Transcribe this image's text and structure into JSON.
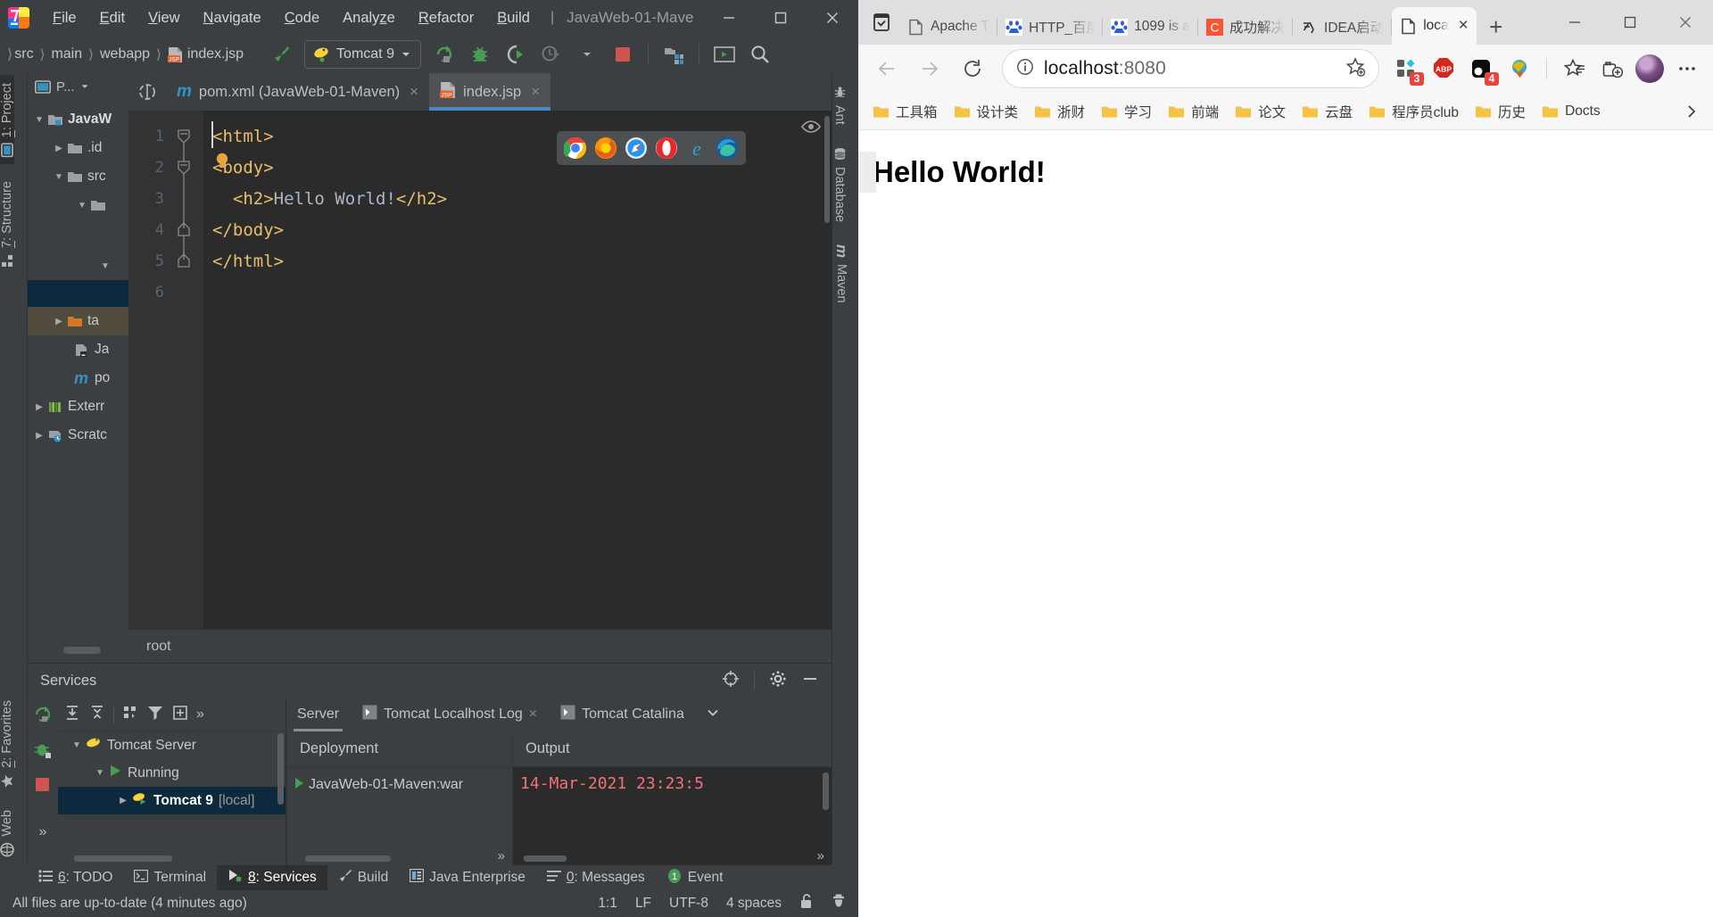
{
  "ide": {
    "window_title": "JavaWeb-01-Mave",
    "menu": [
      {
        "label": "File",
        "mn": "F"
      },
      {
        "label": "Edit",
        "mn": "E"
      },
      {
        "label": "View",
        "mn": "V"
      },
      {
        "label": "Navigate",
        "mn": "N"
      },
      {
        "label": "Code",
        "mn": "C"
      },
      {
        "label": "Analyze",
        "mn": "z"
      },
      {
        "label": "Refactor",
        "mn": "R"
      },
      {
        "label": "Build",
        "mn": "B"
      }
    ],
    "menu_separator": "|",
    "window_buttons": {
      "minimize": "minimize-icon",
      "maximize": "maximize-icon",
      "close": "close-icon"
    },
    "breadcrumb": [
      "src",
      "main",
      "webapp",
      "index.jsp"
    ],
    "run_config": "Tomcat 9",
    "toolbar_icons": [
      "hammer-icon",
      "run-icon",
      "debug-icon",
      "run-coverage-icon",
      "profile-icon",
      "stop-icon",
      "project-structure-icon",
      "update-app-icon",
      "search-everywhere-icon"
    ],
    "left_tool_tabs": [
      {
        "label": "1: Project",
        "mn": "1",
        "icon": "project-icon",
        "selected": true
      },
      {
        "label": "7: Structure",
        "mn": "7",
        "icon": "structure-icon",
        "selected": false
      },
      {
        "label": "2: Favorites",
        "mn": "2",
        "icon": "star-icon",
        "selected": false
      },
      {
        "label": "Web",
        "mn": "",
        "icon": "web-icon",
        "selected": false
      }
    ],
    "right_tool_tabs": [
      {
        "label": "Ant",
        "icon": "ant-icon"
      },
      {
        "label": "Database",
        "icon": "database-icon"
      },
      {
        "label": "Maven",
        "icon": "maven-icon"
      }
    ],
    "project_panel": {
      "title": "P...",
      "tree": [
        {
          "label": "JavaW",
          "indent": 0,
          "arrow": "down",
          "icon": "module-folder",
          "bold": true,
          "sel": ""
        },
        {
          "label": ".id",
          "indent": 1,
          "arrow": "right",
          "icon": "folder",
          "bold": false,
          "sel": ""
        },
        {
          "label": "src",
          "indent": 1,
          "arrow": "down",
          "icon": "folder",
          "bold": false,
          "sel": ""
        },
        {
          "label": "",
          "indent": 2,
          "arrow": "down",
          "icon": "folder-blue",
          "bold": false,
          "sel": ""
        },
        {
          "label": "",
          "indent": 3,
          "arrow": "down",
          "icon": "none",
          "bold": false,
          "sel": ""
        },
        {
          "label": "",
          "indent": 2,
          "arrow": "",
          "icon": "none",
          "bold": false,
          "sel": "blue"
        },
        {
          "label": "ta",
          "indent": 1,
          "arrow": "right",
          "icon": "folder-orange",
          "bold": false,
          "sel": "brown"
        },
        {
          "label": "Ja",
          "indent": 2,
          "arrow": "",
          "icon": "file-jar",
          "bold": false,
          "sel": ""
        },
        {
          "label": "po",
          "indent": 2,
          "arrow": "",
          "icon": "maven-m",
          "bold": false,
          "sel": ""
        },
        {
          "label": "Exterr",
          "indent": 0,
          "arrow": "right",
          "icon": "libs",
          "bold": false,
          "sel": ""
        },
        {
          "label": "Scratc",
          "indent": 0,
          "arrow": "right",
          "icon": "scratch",
          "bold": false,
          "sel": ""
        }
      ]
    },
    "editor": {
      "tabs": [
        {
          "label": "pom.xml (JavaWeb-01-Maven)",
          "icon": "maven-m",
          "active": false,
          "close": "×"
        },
        {
          "label": "index.jsp",
          "icon": "jsp-icon",
          "active": true,
          "close": "×"
        }
      ],
      "line_numbers": [
        "1",
        "2",
        "3",
        "4",
        "5",
        "6"
      ],
      "lines": [
        "<html>",
        "<body>",
        "  <h2>Hello World!</h2>",
        "</body>",
        "</html>",
        ""
      ],
      "breadcrumb": "root",
      "browser_popup_icons": [
        "chrome-icon",
        "firefox-icon",
        "safari-icon",
        "opera-icon",
        "ie-icon",
        "edge-icon"
      ]
    },
    "services": {
      "title": "Services",
      "header_icons": [
        "locate-icon",
        "settings-gear-icon",
        "hide-icon"
      ],
      "toolbar_icons": [
        "expand-all-icon",
        "collapse-all-icon",
        "group-icon",
        "filter-icon",
        "add-icon",
        "more-icon"
      ],
      "run_strip_icons": [
        "rerun-icon",
        "debug-icon",
        "stop-icon",
        "more-icon"
      ],
      "tree": [
        {
          "label": "Tomcat Server",
          "indent": 0,
          "arrow": "down",
          "icon": "tomcat-icon",
          "sel": false,
          "bold": false,
          "dim": ""
        },
        {
          "label": "Running",
          "indent": 1,
          "arrow": "down",
          "icon": "run-green-icon",
          "sel": false,
          "bold": false,
          "dim": ""
        },
        {
          "label": "Tomcat 9",
          "indent": 2,
          "arrow": "right",
          "icon": "tomcat-run-icon",
          "sel": true,
          "bold": true,
          "dim": "[local]"
        }
      ],
      "tabs": [
        {
          "label": "Server",
          "icon": "",
          "active": true,
          "close": ""
        },
        {
          "label": "Tomcat Localhost Log",
          "icon": "console-icon",
          "active": false,
          "close": "×"
        },
        {
          "label": "Tomcat Catalina",
          "icon": "console-icon",
          "active": false,
          "close": ""
        }
      ],
      "tabs_overflow": "chevron-down-icon",
      "columns": [
        {
          "header": "Deployment",
          "value": "JavaWeb-01-Maven:war"
        },
        {
          "header": "Output",
          "value": "14-Mar-2021 23:23:5"
        }
      ]
    },
    "bottom_tools": [
      {
        "label": "6: TODO",
        "mn": "6",
        "icon": "todo-icon",
        "selected": false
      },
      {
        "label": "Terminal",
        "mn": "",
        "icon": "terminal-icon",
        "selected": false
      },
      {
        "label": "8: Services",
        "mn": "8",
        "icon": "services-icon",
        "selected": true
      },
      {
        "label": "Build",
        "mn": "",
        "icon": "build-icon",
        "selected": false
      },
      {
        "label": "Java Enterprise",
        "mn": "",
        "icon": "java-ee-icon",
        "selected": false
      },
      {
        "label": "0: Messages",
        "mn": "0",
        "icon": "messages-icon",
        "selected": false
      },
      {
        "label": "Event",
        "mn": "",
        "icon": "event-log-icon",
        "selected": false,
        "badge": "1"
      }
    ],
    "status": {
      "message": "All files are up-to-date (4 minutes ago)",
      "caret": "1:1",
      "line_separator": "LF",
      "encoding": "UTF-8",
      "indent": "4 spaces",
      "lock_icon": "unlocked-icon",
      "inspector_icon": "hector-icon"
    }
  },
  "browser": {
    "collections_icon": "collections-icon",
    "tabs": [
      {
        "label": "Apache T",
        "favicon": "page-icon",
        "active": false
      },
      {
        "label": "HTTP_百度",
        "favicon": "baidu-icon",
        "active": false
      },
      {
        "label": "1099 is a",
        "favicon": "baidu-icon",
        "active": false
      },
      {
        "label": "成功解决",
        "favicon": "csdn-icon",
        "active": false
      },
      {
        "label": "IDEA启动",
        "favicon": "zhihu-icon",
        "active": false
      },
      {
        "label": "loca",
        "favicon": "page-icon",
        "active": true,
        "close": "×"
      }
    ],
    "new_tab": "+",
    "window_buttons": {
      "minimize": "minimize-icon",
      "maximize": "maximize-icon",
      "close": "close-icon"
    },
    "nav": {
      "back": "back-arrow-icon",
      "forward": "forward-arrow-icon",
      "reload": "reload-icon",
      "info": "info-icon",
      "url": "localhost",
      "url_port": ":8080",
      "favorite": "add-favorite-icon"
    },
    "toolbar_right": [
      {
        "name": "extensions-icon",
        "badge": "3"
      },
      {
        "name": "adblock-plus-icon",
        "badge": ""
      },
      {
        "name": "tampermonkey-icon",
        "badge": "4"
      },
      {
        "name": "idm-icon",
        "badge": ""
      },
      {
        "name": "favorites-star-icon",
        "badge": ""
      },
      {
        "name": "collections-add-icon",
        "badge": ""
      },
      {
        "name": "profile-avatar",
        "badge": ""
      },
      {
        "name": "settings-more-icon",
        "badge": ""
      }
    ],
    "bookmarks": [
      "工具箱",
      "设计类",
      "浙财",
      "学习",
      "前端",
      "论文",
      "云盘",
      "程序员club",
      "历史",
      "Docts"
    ],
    "bookmarks_overflow": "chevron-right-icon",
    "page": {
      "heading": "Hello World!"
    }
  },
  "colors": {
    "ide_bg": "#3c3f41",
    "editor_bg": "#2b2b2b",
    "accent_blue": "#4a88c7",
    "selection_blue": "#0d293e",
    "tag_orange": "#e8bf6a",
    "log_red": "#f07178",
    "green_run": "#499c54",
    "badge_red": "#e8453c"
  }
}
